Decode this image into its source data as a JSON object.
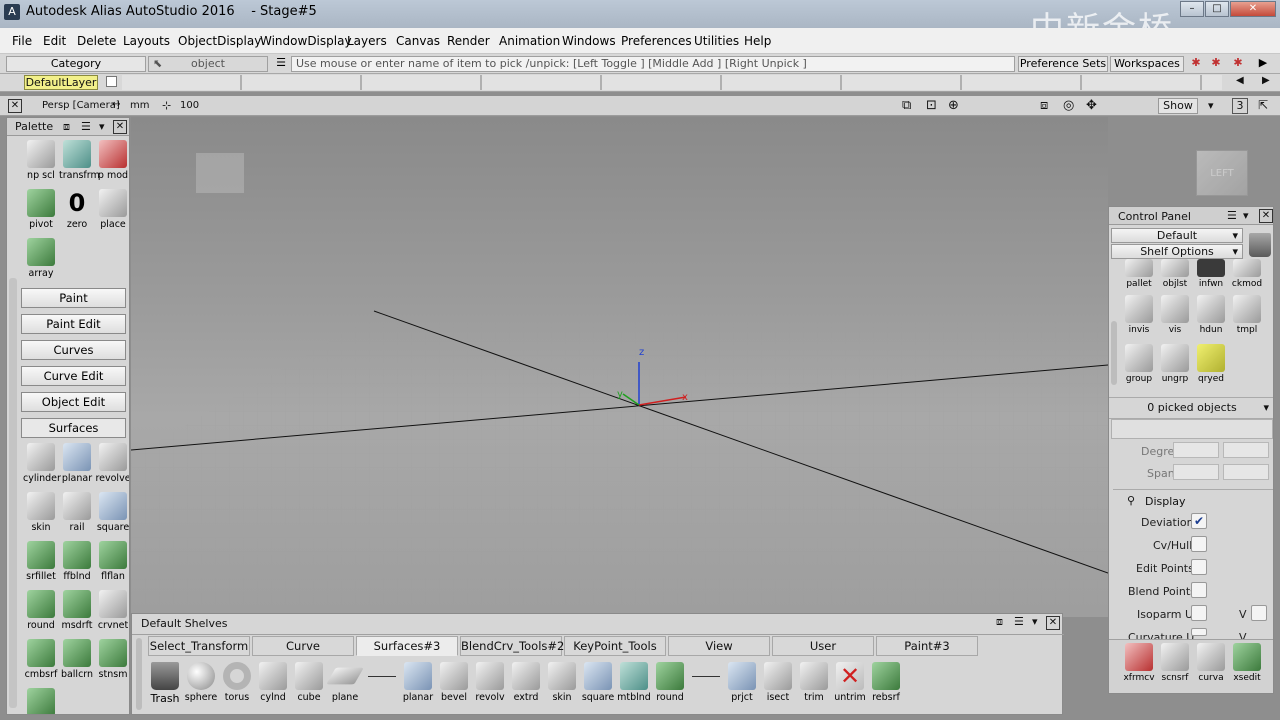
{
  "window": {
    "title": "Autodesk Alias AutoStudio 2016    - Stage#5",
    "watermark": "中新金桥",
    "btn_min": "–",
    "btn_max": "□",
    "btn_close": "✕"
  },
  "menu": [
    "File",
    "Edit",
    "Delete",
    "Layouts",
    "ObjectDisplay",
    "WindowDisplay",
    "Layers",
    "Canvas",
    "Render",
    "Animation",
    "Windows",
    "Preferences",
    "Utilities",
    "Help"
  ],
  "toolbar": {
    "category": "Category",
    "object": "object",
    "pick_hint": "Use mouse or enter name of item to pick /unpick: [Left Toggle ] [Middle Add ] [Right Unpick ]",
    "preference_sets": "Preference Sets",
    "workspaces": "Workspaces"
  },
  "layer": {
    "default": "DefaultLayer"
  },
  "viewbar": {
    "camera": "Persp [Camera]",
    "units": "mm",
    "scale": "100",
    "show": "Show",
    "count": "3"
  },
  "viewport": {
    "cube_label": "LEFT",
    "axis_x": "x",
    "axis_y": "y",
    "axis_z": "z"
  },
  "palette": {
    "title": "Palette",
    "tools_top": [
      {
        "label": "np scl",
        "icon": "nonprop-scale-icon"
      },
      {
        "label": "transfrm",
        "icon": "transform-icon"
      },
      {
        "label": "p mod",
        "icon": "proportional-modify-icon"
      },
      {
        "label": "pivot",
        "icon": "pivot-icon"
      },
      {
        "label": "zero",
        "icon": "zero-icon"
      },
      {
        "label": "place",
        "icon": "place-icon"
      },
      {
        "label": "array",
        "icon": "array-icon"
      }
    ],
    "zero_glyph": "0",
    "categories": [
      "Paint",
      "Paint Edit",
      "Curves",
      "Curve Edit",
      "Object Edit"
    ],
    "surfaces_label": "Surfaces",
    "surface_tools": [
      {
        "label": "cylinder",
        "icon": "cylinder-icon"
      },
      {
        "label": "planar",
        "icon": "planar-icon"
      },
      {
        "label": "revolve",
        "icon": "revolve-icon"
      },
      {
        "label": "skin",
        "icon": "skin-icon"
      },
      {
        "label": "rail",
        "icon": "rail-icon"
      },
      {
        "label": "square",
        "icon": "square-icon"
      },
      {
        "label": "srfillet",
        "icon": "srfillet-icon"
      },
      {
        "label": "ffblnd",
        "icon": "ffblend-icon"
      },
      {
        "label": "flflan",
        "icon": "flange-icon"
      },
      {
        "label": "round",
        "icon": "round-icon"
      },
      {
        "label": "msdrft",
        "icon": "draft-icon"
      },
      {
        "label": "crvnet",
        "icon": "curve-network-icon"
      },
      {
        "label": "cmbsrf",
        "icon": "combine-surface-icon"
      },
      {
        "label": "ballcrn",
        "icon": "ball-corner-icon"
      },
      {
        "label": "stnsm",
        "icon": "stitch-icon"
      }
    ]
  },
  "control_panel": {
    "title": "Control Panel",
    "preset": "Default",
    "shelf_options": "Shelf Options",
    "tools": [
      {
        "label": "pallet",
        "icon": "pallet-icon"
      },
      {
        "label": "objlst",
        "icon": "object-list-icon"
      },
      {
        "label": "infwn",
        "icon": "info-window-icon"
      },
      {
        "label": "ckmod",
        "icon": "check-model-icon"
      },
      {
        "label": "invis",
        "icon": "invisible-icon"
      },
      {
        "label": "vis",
        "icon": "visible-icon"
      },
      {
        "label": "hdun",
        "icon": "hide-unselected-icon"
      },
      {
        "label": "tmpl",
        "icon": "template-icon"
      },
      {
        "label": "group",
        "icon": "group-icon"
      },
      {
        "label": "ungrp",
        "icon": "ungroup-icon"
      },
      {
        "label": "qryed",
        "icon": "query-edit-icon"
      }
    ],
    "picked": "0 picked objects",
    "degree": "Degree",
    "spans": "Spans",
    "display_section": "Display",
    "display_options": [
      {
        "label": "Deviation",
        "checked": true
      },
      {
        "label": "Cv/Hull",
        "checked": false
      },
      {
        "label": "Edit Points",
        "checked": false
      },
      {
        "label": "Blend Points",
        "checked": false
      },
      {
        "label": "Isoparm U",
        "checked": false
      },
      {
        "label": "Curvature U",
        "checked": false
      }
    ],
    "v_label": "V",
    "bottom_tools": [
      {
        "label": "xfrmcv",
        "icon": "transform-cv-icon"
      },
      {
        "label": "scnsrf",
        "icon": "scan-surface-icon"
      },
      {
        "label": "curva",
        "icon": "curvature-icon"
      },
      {
        "label": "xsedit",
        "icon": "cross-section-edit-icon"
      }
    ]
  },
  "shelf": {
    "title": "Default Shelves",
    "tabs": [
      "Select_Transform",
      "Curve",
      "Surfaces#3",
      "BlendCrv_Tools#2",
      "KeyPoint_Tools",
      "View",
      "User",
      "Paint#3"
    ],
    "active_tab": "Surfaces#3",
    "tools": [
      {
        "label": "Trash",
        "icon": "trash-icon"
      },
      {
        "label": "sphere",
        "icon": "sphere-icon"
      },
      {
        "label": "torus",
        "icon": "torus-icon"
      },
      {
        "label": "cylnd",
        "icon": "cylinder-icon"
      },
      {
        "label": "cube",
        "icon": "cube-icon"
      },
      {
        "label": "plane",
        "icon": "plane-icon"
      },
      {
        "label": "planar",
        "icon": "planar-icon"
      },
      {
        "label": "bevel",
        "icon": "bevel-icon"
      },
      {
        "label": "revolv",
        "icon": "revolve-icon"
      },
      {
        "label": "extrd",
        "icon": "extrude-icon"
      },
      {
        "label": "skin",
        "icon": "skin-icon"
      },
      {
        "label": "square",
        "icon": "square-icon"
      },
      {
        "label": "mtblnd",
        "icon": "multi-blend-icon"
      },
      {
        "label": "round",
        "icon": "round-icon"
      },
      {
        "label": "prjct",
        "icon": "project-icon"
      },
      {
        "label": "isect",
        "icon": "intersect-icon"
      },
      {
        "label": "trim",
        "icon": "trim-icon"
      },
      {
        "label": "untrim",
        "icon": "untrim-icon"
      },
      {
        "label": "rebsrf",
        "icon": "rebuild-surface-icon"
      }
    ]
  }
}
